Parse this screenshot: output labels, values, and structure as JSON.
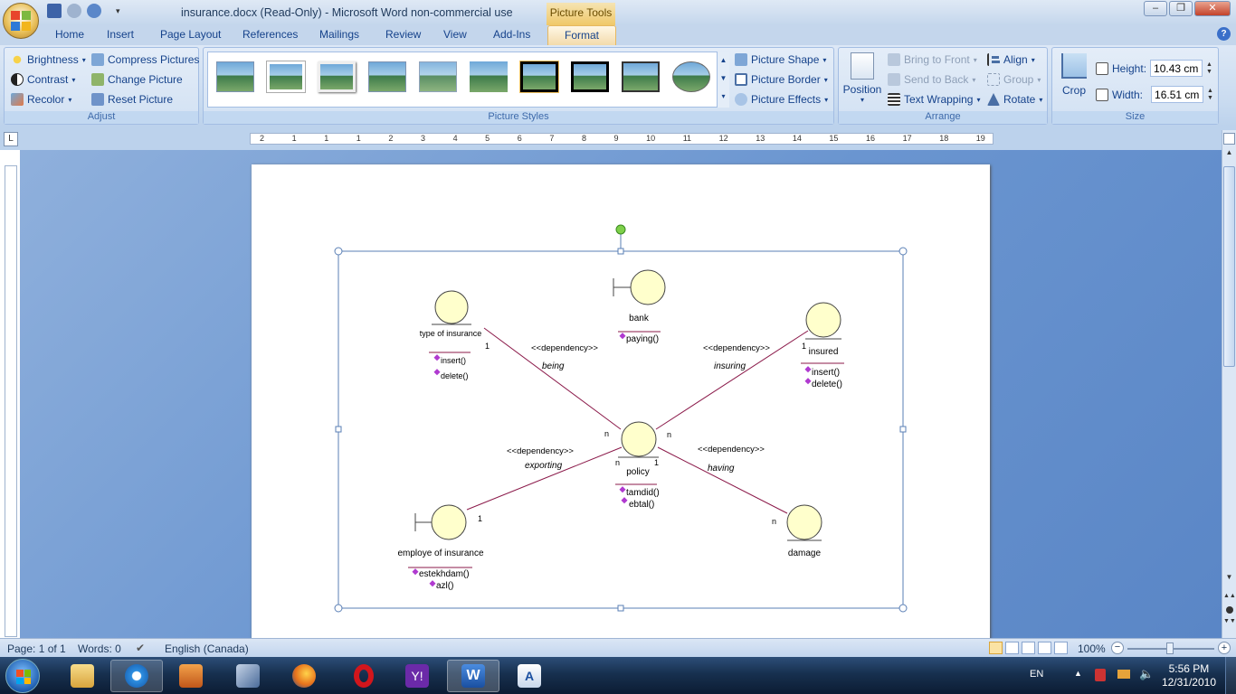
{
  "window": {
    "title": "insurance.docx (Read-Only)  -  Microsoft Word non-commercial use",
    "context_tab": "Picture Tools",
    "help": "?"
  },
  "tabs": [
    "Home",
    "Insert",
    "Page Layout",
    "References",
    "Mailings",
    "Review",
    "View",
    "Add-Ins",
    "Format"
  ],
  "active_tab": "Format",
  "ribbon": {
    "adjust": {
      "label": "Adjust",
      "brightness": "Brightness",
      "contrast": "Contrast",
      "recolor": "Recolor",
      "compress": "Compress Pictures",
      "change": "Change Picture",
      "reset": "Reset Picture"
    },
    "styles": {
      "label": "Picture Styles",
      "shape": "Picture Shape",
      "border": "Picture Border",
      "effects": "Picture Effects"
    },
    "arrange": {
      "label": "Arrange",
      "position": "Position",
      "bring_front": "Bring to Front",
      "send_back": "Send to Back",
      "text_wrapping": "Text Wrapping",
      "align": "Align",
      "group": "Group",
      "rotate": "Rotate"
    },
    "size": {
      "label": "Size",
      "crop": "Crop",
      "height_label": "Height:",
      "height_value": "10.43 cm",
      "width_label": "Width:",
      "width_value": "16.51 cm"
    }
  },
  "ruler_numbers": [
    "2",
    "1",
    "1",
    "1",
    "2",
    "3",
    "4",
    "5",
    "6",
    "7",
    "8",
    "9",
    "10",
    "11",
    "12",
    "13",
    "14",
    "15",
    "16",
    "17",
    "18",
    "19"
  ],
  "diagram": {
    "nodes": {
      "type_of_insurance": {
        "name": "type of insurance",
        "ops": [
          "insert()",
          "delete()"
        ],
        "mult": "1"
      },
      "bank": {
        "name": "bank",
        "ops": [
          "paying()"
        ]
      },
      "insured": {
        "name": "insured",
        "ops": [
          "insert()",
          "delete()"
        ],
        "mult": "1"
      },
      "policy": {
        "name": "policy",
        "ops": [
          "tamdid()",
          "ebtal()"
        ]
      },
      "employe": {
        "name": "employe of insurance",
        "ops": [
          "estekhdam()",
          "azl()"
        ],
        "mult": "1"
      },
      "damage": {
        "name": "damage",
        "mult": "n"
      }
    },
    "relations": {
      "being": {
        "stereo": "<<dependency>>",
        "role": "being"
      },
      "insuring": {
        "stereo": "<<dependency>>",
        "role": "insuring"
      },
      "exporting": {
        "stereo": "<<dependency>>",
        "role": "exporting"
      },
      "having": {
        "stereo": "<<dependency>>",
        "role": "having"
      }
    },
    "policy_mults": {
      "top_left": "n",
      "top_right": "n",
      "bottom_left": "n",
      "bottom_right": "1"
    }
  },
  "status": {
    "page": "Page: 1 of 1",
    "words": "Words: 0",
    "language": "English (Canada)",
    "zoom": "100%"
  },
  "tray": {
    "lang": "EN",
    "time": "5:56 PM",
    "date": "12/31/2010"
  }
}
